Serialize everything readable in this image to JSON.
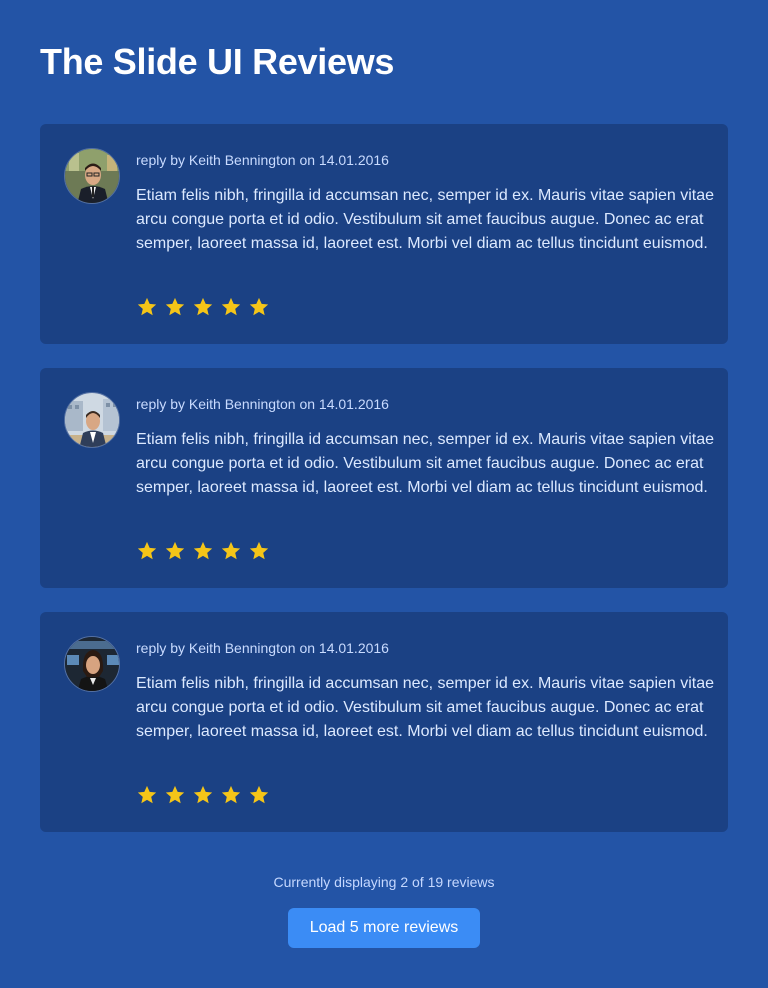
{
  "page": {
    "title": "The Slide UI Reviews"
  },
  "reviews": [
    {
      "byline": "reply by Keith Bennington on 14.01.2016",
      "text": "Etiam felis nibh, fringilla id accumsan nec, semper id ex. Mauris vitae sapien vitae arcu congue porta et id odio. Vestibulum sit amet faucibus augue. Donec ac erat semper, laoreet massa id, laoreet est. Morbi vel diam ac tellus tincidunt euismod.",
      "rating": 5,
      "rating_max": 5,
      "avatar_icon": "man-suit-portrait"
    },
    {
      "byline": "reply by Keith Bennington on 14.01.2016",
      "text": "Etiam felis nibh, fringilla id accumsan nec, semper id ex. Mauris vitae sapien vitae arcu congue porta et id odio. Vestibulum sit amet faucibus augue. Donec ac erat semper, laoreet massa id, laoreet est. Morbi vel diam ac tellus tincidunt euismod.",
      "rating": 5,
      "rating_max": 5,
      "avatar_icon": "man-building-portrait"
    },
    {
      "byline": "reply by Keith Bennington on 14.01.2016",
      "text": "Etiam felis nibh, fringilla id accumsan nec, semper id ex. Mauris vitae sapien vitae arcu congue porta et id odio. Vestibulum sit amet faucibus augue. Donec ac erat semper, laoreet massa id, laoreet est. Morbi vel diam ac tellus tincidunt euismod.",
      "rating": 5,
      "rating_max": 5,
      "avatar_icon": "woman-office-portrait"
    }
  ],
  "footer": {
    "status": "Currently displaying 2 of 19 reviews",
    "load_more_label": "Load 5 more reviews"
  },
  "colors": {
    "background": "#2354a6",
    "card": "#1b4184",
    "star": "#f5c518",
    "button": "#3b8cf5"
  }
}
